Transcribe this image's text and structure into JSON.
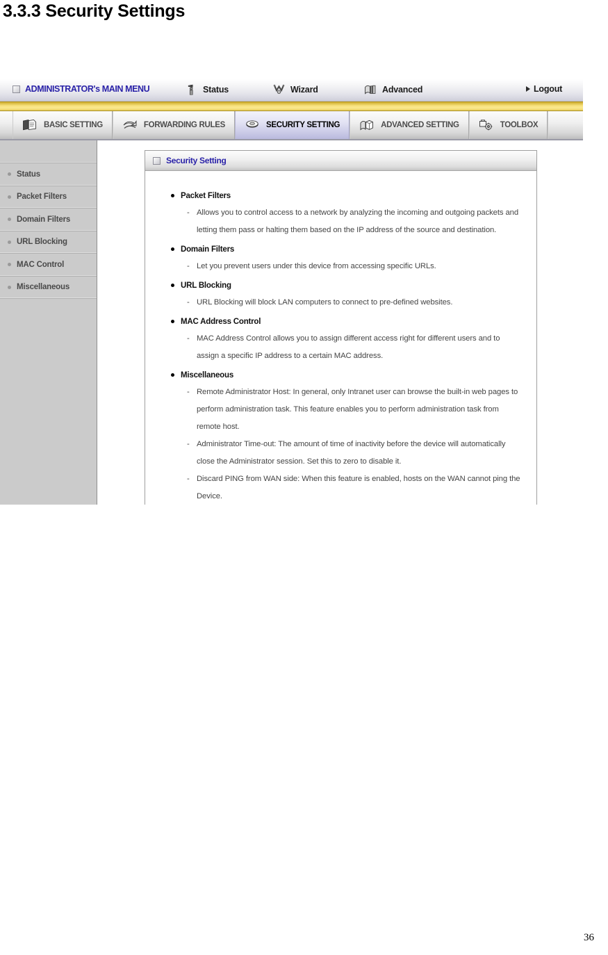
{
  "document": {
    "heading": "3.3.3 Security Settings",
    "page_number": "36"
  },
  "router_ui": {
    "top_menu": {
      "main_menu_label": "ADMINISTRATOR's MAIN MENU",
      "main_menu_icon": "square-box-icon",
      "links": [
        {
          "label": "Status",
          "icon": "signpost-person-icon"
        },
        {
          "label": "Wizard",
          "icon": "wizard-wand-icon"
        },
        {
          "label": "Advanced",
          "icon": "advanced-book-icon"
        },
        {
          "label": "Logout",
          "icon": "arrow-right-icon"
        }
      ]
    },
    "tabs": [
      {
        "label": "BASIC SETTING",
        "icon": "documents-folder-icon",
        "active": false
      },
      {
        "label": "FORWARDING RULES",
        "icon": "forwarding-arrow-icon",
        "active": false
      },
      {
        "label": "SECURITY SETTING",
        "icon": "shield-nut-icon",
        "active": true
      },
      {
        "label": "ADVANCED SETTING",
        "icon": "advanced-cube-icon",
        "active": false
      },
      {
        "label": "TOOLBOX",
        "icon": "toolbox-gear-icon",
        "active": false
      }
    ],
    "sidebar": {
      "items": [
        {
          "label": "Status"
        },
        {
          "label": "Packet Filters"
        },
        {
          "label": "Domain Filters"
        },
        {
          "label": "URL Blocking"
        },
        {
          "label": "MAC Control"
        },
        {
          "label": "Miscellaneous"
        }
      ]
    },
    "panel": {
      "title": "Security Setting",
      "title_icon": "square-box-icon",
      "sections": [
        {
          "heading": "Packet Filters",
          "items": [
            "Allows you to control access to a network by analyzing the incoming and outgoing packets and letting them pass or halting them based on the IP address of the source and destination."
          ]
        },
        {
          "heading": "Domain Filters",
          "items": [
            "Let you prevent users under this device from accessing specific URLs."
          ]
        },
        {
          "heading": "URL Blocking",
          "items": [
            "URL Blocking will block LAN computers to connect to pre-defined websites."
          ]
        },
        {
          "heading": "MAC Address Control",
          "items": [
            "MAC Address Control allows you to assign different access right for different users and to assign a specific IP address to a certain MAC address."
          ]
        },
        {
          "heading": "Miscellaneous",
          "items": [
            "Remote Administrator Host: In general, only Intranet user can browse the built-in web pages to perform administration task. This feature enables you to perform administration task from remote host.",
            "Administrator Time-out: The amount of time of inactivity before the device will automatically close the Administrator session. Set this to zero to disable it.",
            "Discard PING from WAN side: When this feature is enabled, hosts on the WAN cannot ping the Device."
          ]
        }
      ]
    },
    "colors": {
      "menu_text_accent": "#2a22a8",
      "gold_band": "#f7e27e",
      "active_tab": "#c8c8e6",
      "sidebar_bg": "#cbcbcb"
    }
  }
}
